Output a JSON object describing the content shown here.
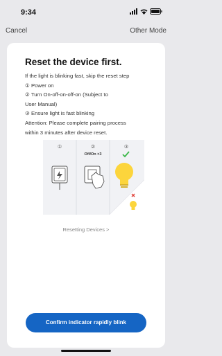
{
  "status_bar": {
    "time": "9:34",
    "icons": [
      "signal-icon",
      "wifi-icon",
      "battery-icon"
    ]
  },
  "nav": {
    "cancel_label": "Cancel",
    "other_mode_label": "Other Mode"
  },
  "card": {
    "title": "Reset the device first.",
    "lines": [
      "If the light is blinking fast, skip the reset step",
      "① Power on",
      "② Turn On-off-on-off-on (Subject to",
      "User Manual)",
      "③ Ensure light is fast blinking",
      "Attention: Please complete pairing process",
      "within 3 minutes after device reset."
    ],
    "illustration": {
      "step_labels": [
        "①",
        "②",
        "③"
      ],
      "step_caption": "Off/On ×3"
    },
    "resetting_link": "Resetting Devices >",
    "confirm_button": "Confirm indicator rapidly blink"
  },
  "colors": {
    "accent": "#1565c4",
    "bulb": "#fcd53c",
    "check": "#3cb84a",
    "cross": "#e0443c"
  }
}
